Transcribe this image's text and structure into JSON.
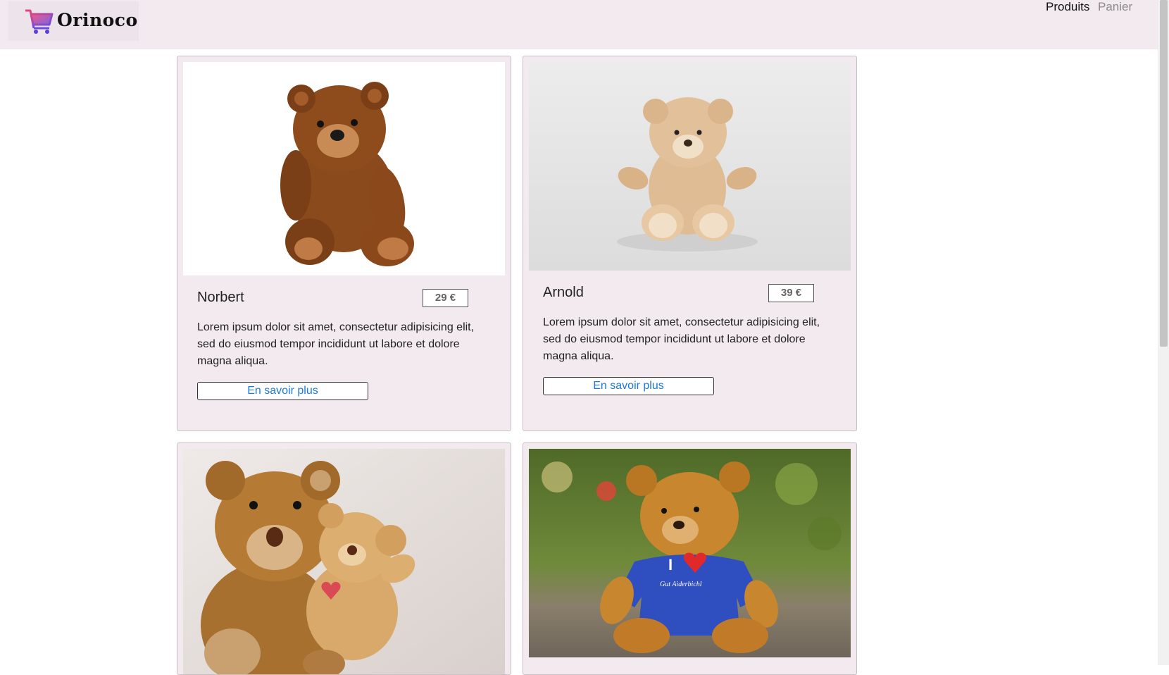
{
  "header": {
    "brand_name": "Orinoco",
    "nav": [
      {
        "label": "Produits",
        "active": true
      },
      {
        "label": "Panier",
        "active": false
      }
    ],
    "background_color": "#f3eaf0"
  },
  "products": [
    {
      "name": "Norbert",
      "price": "29 €",
      "description": "Lorem ipsum dolor sit amet, consectetur adipisicing elit, sed do eiusmod tempor incididunt ut labore et dolore magna aliqua.",
      "button_label": "En savoir plus",
      "image_icon": "brown-teddy-bear-image"
    },
    {
      "name": "Arnold",
      "price": "39 €",
      "description": "Lorem ipsum dolor sit amet, consectetur adipisicing elit, sed do eiusmod tempor incididunt ut labore et dolore magna aliqua.",
      "button_label": "En savoir plus",
      "image_icon": "beige-teddy-bear-image"
    },
    {
      "image_icon": "two-teddy-bears-image"
    },
    {
      "image_icon": "teddy-bear-blue-shirt-image",
      "shirt_text": "I",
      "shirt_subtext": "Gut Aiderbichl"
    }
  ],
  "colors": {
    "accent_link": "#1a7ae0",
    "card_bg": "#f3eaf0"
  }
}
